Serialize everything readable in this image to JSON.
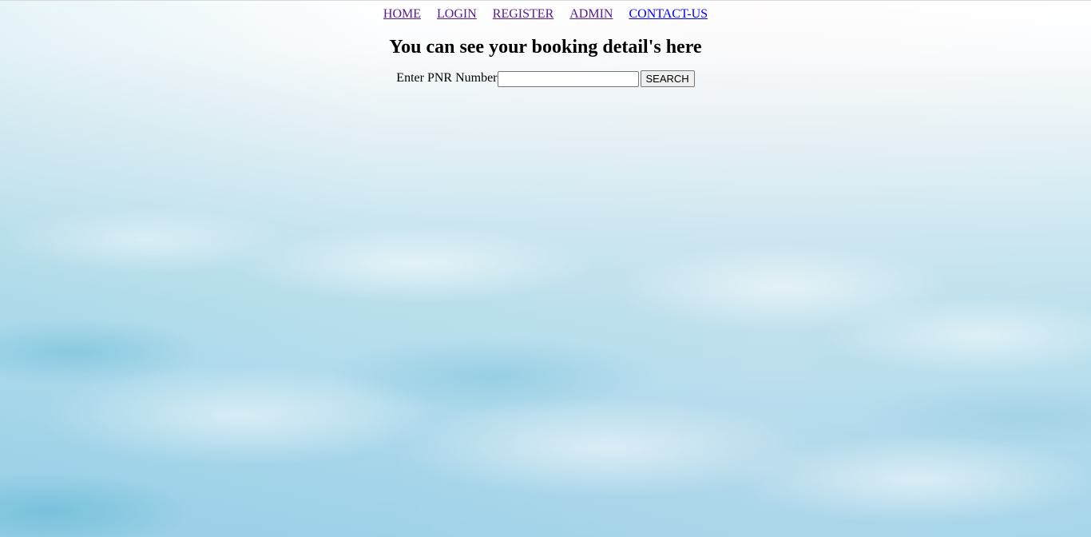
{
  "nav": {
    "items": [
      {
        "label": "HOME"
      },
      {
        "label": "LOGIN"
      },
      {
        "label": "REGISTER"
      },
      {
        "label": "ADMIN"
      },
      {
        "label": "CONTACT-US"
      }
    ]
  },
  "page": {
    "heading": "You can see your booking detail's here"
  },
  "search": {
    "label": "Enter PNR Number",
    "value": "",
    "button_label": "SEARCH"
  },
  "colors": {
    "link_visited": "#551a8b",
    "link_unvisited": "#0000ee"
  }
}
